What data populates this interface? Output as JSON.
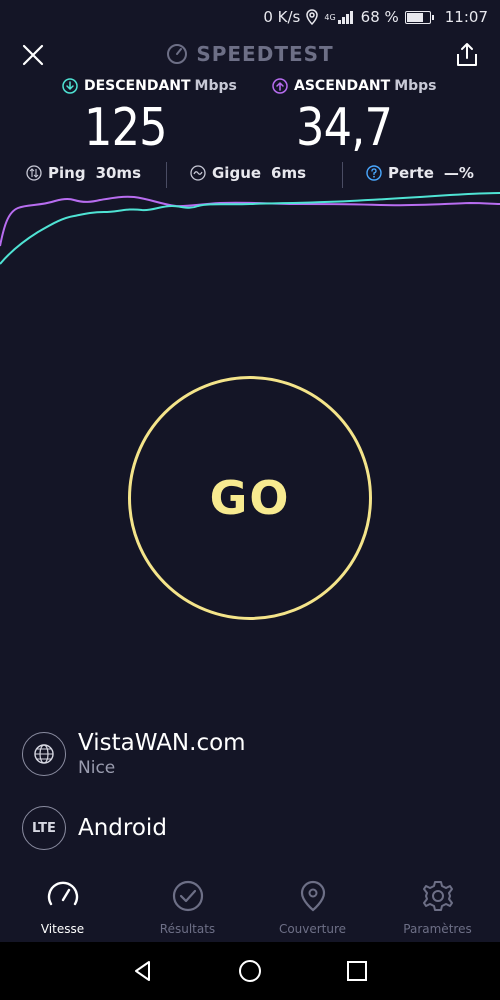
{
  "status_bar": {
    "speed": "0 K/s",
    "network": "4G",
    "battery": "68 %",
    "time": "11:07"
  },
  "header": {
    "brand": "SPEEDTEST",
    "close_icon": "close-icon",
    "share_icon": "share-icon"
  },
  "download": {
    "label": "DESCENDANT",
    "unit": "Mbps",
    "value": "125",
    "color": "#4fe3d4"
  },
  "upload": {
    "label": "ASCENDANT",
    "unit": "Mbps",
    "value": "34,7",
    "color": "#b86df0"
  },
  "metrics": {
    "ping": {
      "label": "Ping",
      "value": "30ms"
    },
    "jitter": {
      "label": "Gigue",
      "value": "6ms"
    },
    "loss": {
      "label": "Perte",
      "value": "—%"
    }
  },
  "go_label": "GO",
  "server": {
    "name": "VistaWAN.com",
    "city": "Nice"
  },
  "connection": {
    "badge": "LTE",
    "name": "Android"
  },
  "nav": [
    {
      "label": "Vitesse",
      "icon": "speedometer-icon",
      "active": true
    },
    {
      "label": "Résultats",
      "icon": "check-circle-icon",
      "active": false
    },
    {
      "label": "Couverture",
      "icon": "map-pin-icon",
      "active": false
    },
    {
      "label": "Paramètres",
      "icon": "gear-icon",
      "active": false
    }
  ],
  "colors": {
    "background": "#141526",
    "accent_go": "#f4e48a",
    "download_line": "#4fe3d4",
    "upload_line": "#b86df0",
    "loss_accent": "#4aa8ff"
  }
}
